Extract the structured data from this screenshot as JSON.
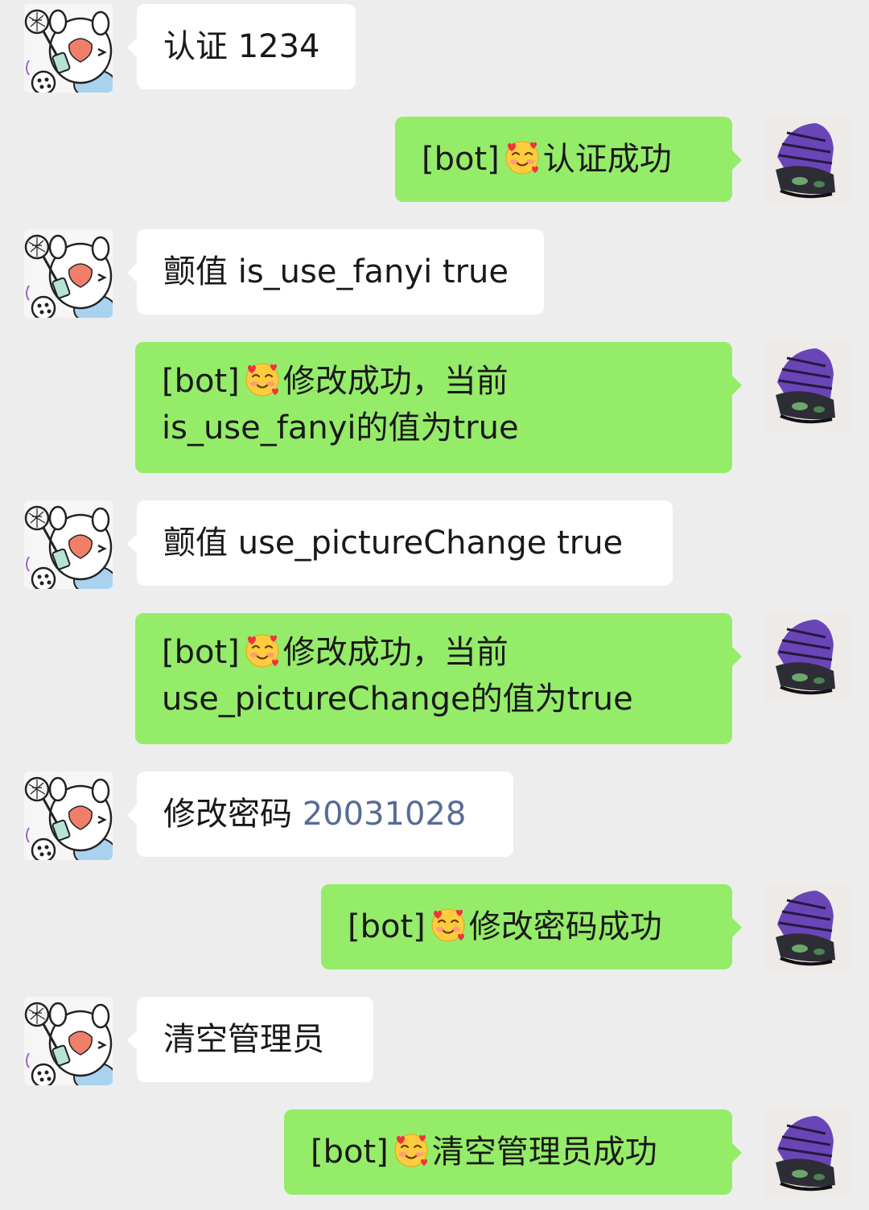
{
  "colors": {
    "background": "#ededed",
    "incoming_bubble": "#ffffff",
    "outgoing_bubble": "#95ec69",
    "link_number": "#576b95"
  },
  "avatars": {
    "incoming": "cartoon-cat-badminton-avatar",
    "outgoing": "purple-cap-avatar"
  },
  "messages": [
    {
      "side": "incoming",
      "text": "认证 1234"
    },
    {
      "side": "outgoing",
      "prefix": "[bot]",
      "icon": "smiling-face-with-hearts-emoji",
      "text": "认证成功"
    },
    {
      "side": "incoming",
      "text": "颤值 is_use_fanyi true"
    },
    {
      "side": "outgoing",
      "prefix": "[bot]",
      "icon": "smiling-face-with-hearts-emoji",
      "line1": "修改成功，当前",
      "line2": "is_use_fanyi的值为true"
    },
    {
      "side": "incoming",
      "text": "颤值 use_pictureChange true"
    },
    {
      "side": "outgoing",
      "prefix": "[bot]",
      "icon": "smiling-face-with-hearts-emoji",
      "line1": "修改成功，当前",
      "line2": "use_pictureChange的值为true"
    },
    {
      "side": "incoming",
      "text": "修改密码",
      "number": "20031028"
    },
    {
      "side": "outgoing",
      "prefix": "[bot]",
      "icon": "smiling-face-with-hearts-emoji",
      "text": "修改密码成功"
    },
    {
      "side": "incoming",
      "text": "清空管理员"
    },
    {
      "side": "outgoing",
      "prefix": "[bot]",
      "icon": "smiling-face-with-hearts-emoji",
      "text": "清空管理员成功"
    }
  ]
}
